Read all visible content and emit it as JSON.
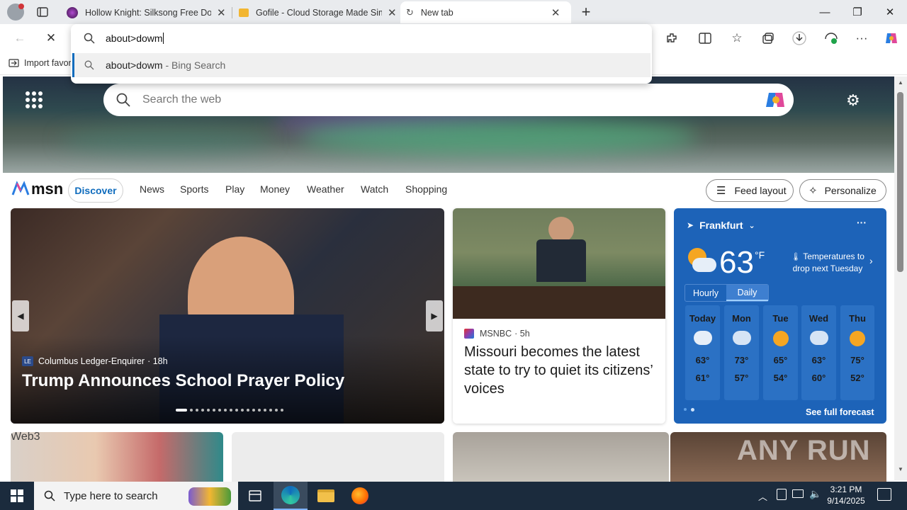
{
  "tabs": [
    {
      "title": "Hollow Knight: Silksong Free Dow",
      "close": "✕"
    },
    {
      "title": "Gofile - Cloud Storage Made Sim",
      "close": "✕"
    },
    {
      "title": "New tab",
      "close": "✕"
    }
  ],
  "new_tab": "+",
  "window_controls": {
    "min": "—",
    "max": "❐",
    "close": "✕"
  },
  "address": {
    "typed": "about>dowm",
    "suggestion_text": "about>dowm",
    "suggestion_suffix": " - Bing Search"
  },
  "favorites_bar": {
    "import_label": "Import favor"
  },
  "search": {
    "placeholder": "Search the web"
  },
  "msn": {
    "logo": "msn"
  },
  "nav": {
    "items": [
      "Discover",
      "News",
      "Sports",
      "Play",
      "Money",
      "Weather",
      "Watch",
      "Shopping"
    ],
    "feed_layout": "Feed layout",
    "personalize": "Personalize"
  },
  "top_story": {
    "source": "Columbus Ledger-Enquirer",
    "source_badge": "LE",
    "age": "· 18h",
    "headline": "Trump Announces School Prayer Policy"
  },
  "mid_story": {
    "source": "MSNBC",
    "age": "· 5h",
    "headline": "Missouri becomes the latest state to try to quiet its citizens’ voices"
  },
  "weather": {
    "city": "Frankfurt",
    "temp": "63",
    "unit": "°F",
    "alert": "Temperatures to drop next Tuesday",
    "tabs": [
      "Hourly",
      "Daily"
    ],
    "days": [
      {
        "name": "Today",
        "high": "63°",
        "low": "61°"
      },
      {
        "name": "Mon",
        "high": "73°",
        "low": "57°"
      },
      {
        "name": "Tue",
        "high": "65°",
        "low": "54°"
      },
      {
        "name": "Wed",
        "high": "63°",
        "low": "60°"
      },
      {
        "name": "Thu",
        "high": "75°",
        "low": "52°"
      }
    ],
    "full_forecast": "See full forecast",
    "more": "···"
  },
  "bottom_row": {
    "label": "Web3"
  },
  "watermark": "ANY RUN",
  "taskbar": {
    "search_placeholder": "Type here to search",
    "time": "3:21 PM",
    "date": "9/14/2025"
  },
  "colors": {
    "accent": "#0f6cbd",
    "weather_bg": "#1d63b8",
    "taskbar": "#1b2b3d"
  }
}
